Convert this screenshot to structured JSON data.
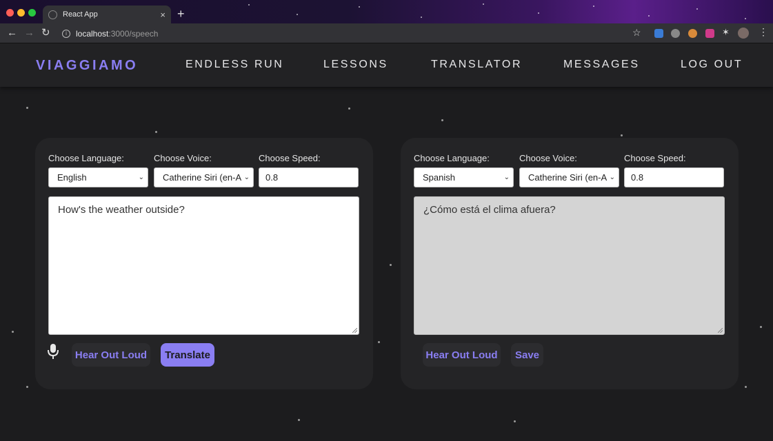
{
  "browser": {
    "tab_title": "React App",
    "tab_close": "×",
    "new_tab": "+",
    "url_host": "localhost",
    "url_path": ":3000/speech"
  },
  "navbar": {
    "brand": "VIAGGIAMO",
    "links": [
      "ENDLESS RUN",
      "LESSONS",
      "TRANSLATOR",
      "MESSAGES",
      "LOG OUT"
    ]
  },
  "source_panel": {
    "language_label": "Choose Language:",
    "language_value": "English",
    "voice_label": "Choose Voice:",
    "voice_value": "Catherine Siri (en-A",
    "speed_label": "Choose Speed:",
    "speed_value": "0.8",
    "text": "How's the weather outside?",
    "hear_label": "Hear Out Loud",
    "translate_label": "Translate"
  },
  "target_panel": {
    "language_label": "Choose Language:",
    "language_value": "Spanish",
    "voice_label": "Choose Voice:",
    "voice_value": "Catherine Siri (en-A",
    "speed_label": "Choose Speed:",
    "speed_value": "0.8",
    "text": "¿Cómo está el clima afuera?",
    "hear_label": "Hear Out Loud",
    "save_label": "Save"
  },
  "colors": {
    "accent": "#8a7ef2",
    "background": "#1c1c1e",
    "card": "#242426",
    "output_area": "#d4d4d4"
  }
}
